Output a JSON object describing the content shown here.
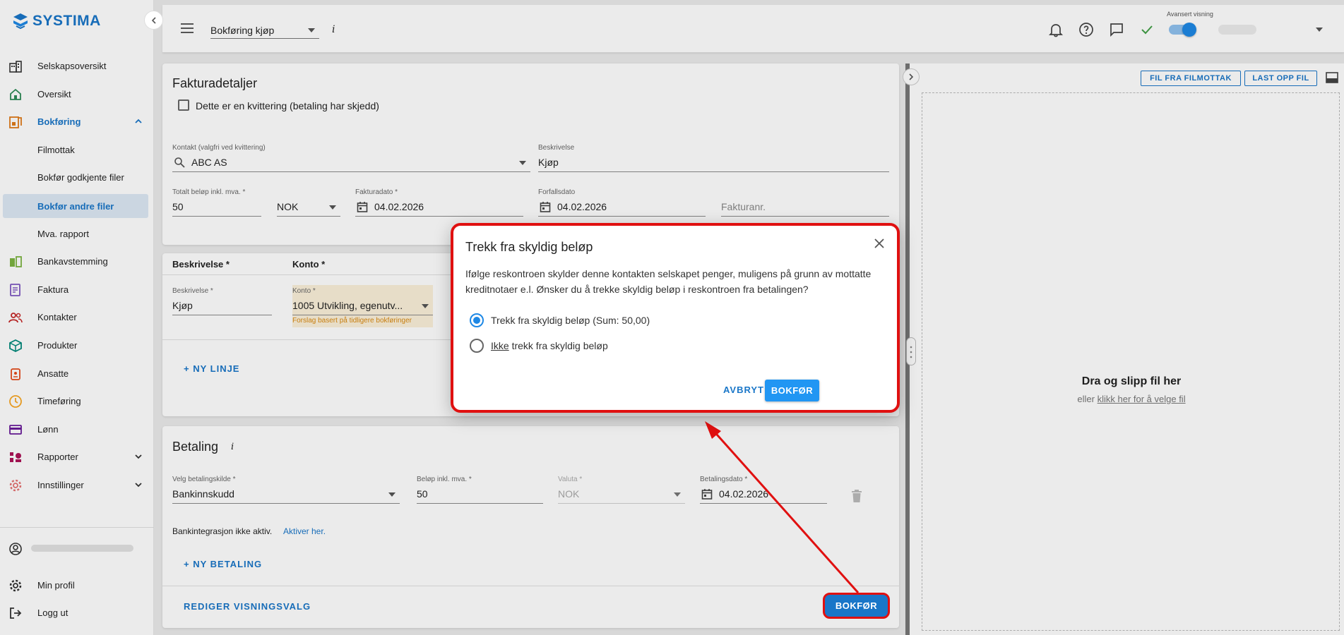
{
  "app": {
    "logo_text": "SYSTIMA"
  },
  "sidebar": {
    "items": [
      {
        "label": "Selskapsoversikt",
        "icon": "company-overview-icon"
      },
      {
        "label": "Oversikt",
        "icon": "home-icon"
      },
      {
        "label": "Bokføring",
        "icon": "bookkeeping-icon"
      },
      {
        "label": "Filmottak"
      },
      {
        "label": "Bokfør godkjente filer"
      },
      {
        "label": "Bokfør andre filer"
      },
      {
        "label": "Mva. rapport"
      },
      {
        "label": "Bankavstemming",
        "icon": "bank-reconciliation-icon"
      },
      {
        "label": "Faktura",
        "icon": "invoice-icon"
      },
      {
        "label": "Kontakter",
        "icon": "contacts-icon"
      },
      {
        "label": "Produkter",
        "icon": "products-icon"
      },
      {
        "label": "Ansatte",
        "icon": "employees-icon"
      },
      {
        "label": "Timeføring",
        "icon": "clock-icon"
      },
      {
        "label": "Lønn",
        "icon": "payroll-icon"
      },
      {
        "label": "Rapporter",
        "icon": "reports-icon"
      },
      {
        "label": "Innstillinger",
        "icon": "settings-icon"
      }
    ],
    "bottom": [
      {
        "label": "Min profil",
        "icon": "gear-icon"
      },
      {
        "label": "Logg ut",
        "icon": "logout-icon"
      }
    ]
  },
  "topbar": {
    "view_select": "Bokføring kjøp",
    "info": "i",
    "advanced_label": "Avansert visning",
    "colors": {
      "accent": "#1e88e5",
      "check": "#43a047"
    }
  },
  "invoice": {
    "title": "Fakturadetaljer",
    "receipt_checkbox": "Dette er en kvittering (betaling har skjedd)",
    "contact_label": "Kontakt (valgfri ved kvittering)",
    "contact_value": "ABC AS",
    "description_label": "Beskrivelse",
    "description_value": "Kjøp",
    "total_label": "Totalt beløp inkl. mva. *",
    "total_value": "50",
    "currency_value": "NOK",
    "invoice_date_label": "Fakturadato *",
    "invoice_date_value": "04.02.2026",
    "due_date_label": "Forfallsdato",
    "due_date_value": "04.02.2026",
    "invoice_number_placeholder": "Fakturanr."
  },
  "lines": {
    "col_description": "Beskrivelse *",
    "col_account": "Konto *",
    "row_description_label": "Beskrivelse *",
    "row_description_value": "Kjøp",
    "row_account_label": "Konto *",
    "row_account_value": "1005 Utvikling, egenutv...",
    "row_account_hint": "Forslag basert på tidligere bokføringer",
    "add_line": "+ NY LINJE"
  },
  "payment": {
    "title": "Betaling",
    "info": "i",
    "source_label": "Velg betalingskilde *",
    "source_value": "Bankinnskudd",
    "amount_label": "Beløp inkl. mva. *",
    "amount_value": "50",
    "currency_label": "Valuta *",
    "currency_value": "NOK",
    "date_label": "Betalingsdato *",
    "date_value": "04.02.2026",
    "bank_text": "Bankintegrasjon ikke aktiv.",
    "bank_link": "Aktiver her.",
    "add_payment": "+ NY BETALING"
  },
  "footer": {
    "edit_view": "REDIGER VISNINGSVALG",
    "submit": "BOKFØR"
  },
  "right_panel": {
    "from_inbox": "FIL FRA FILMOTTAK",
    "upload": "LAST OPP FIL",
    "drop_title": "Dra og slipp fil her",
    "drop_prefix": "eller",
    "drop_link": "klikk her for å velge fil"
  },
  "dialog": {
    "title": "Trekk fra skyldig beløp",
    "body": "Ifølge reskontroen skylder denne kontakten selskapet penger, muligens på grunn av mottatte kreditnotaer e.l. Ønsker du å trekke skyldig beløp i reskontroen fra betalingen?",
    "option_1": "Trekk fra skyldig beløp (Sum: 50,00)",
    "option_2_underlined": "Ikke",
    "option_2_rest": "trekk fra skyldig beløp",
    "cancel": "AVBRYT",
    "confirm": "BOKFØR",
    "highlight_color": "#e01010"
  }
}
